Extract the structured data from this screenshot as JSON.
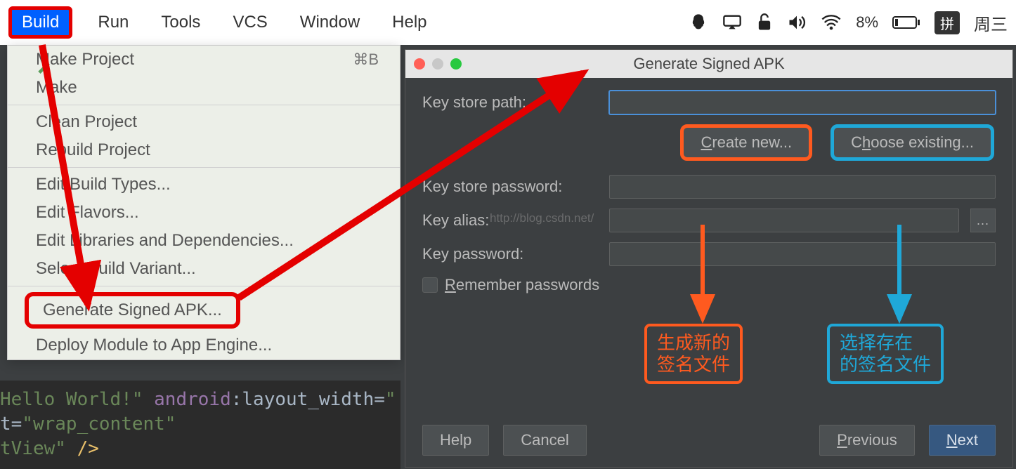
{
  "menubar": {
    "items": [
      "Build",
      "Run",
      "Tools",
      "VCS",
      "Window",
      "Help"
    ],
    "battery": "8%",
    "ime": "拼",
    "day": "周三"
  },
  "dropdown": {
    "make_project": "Make Project",
    "make_project_shortcut": "⌘B",
    "make": "Make",
    "clean": "Clean Project",
    "rebuild": "Rebuild Project",
    "edit_types": "Edit Build Types...",
    "edit_flavors": "Edit Flavors...",
    "edit_libs": "Edit Libraries and Dependencies...",
    "select_variant": "Select Build Variant...",
    "generate_apk": "Generate Signed APK...",
    "deploy": "Deploy Module to App Engine..."
  },
  "code": {
    "line1_a": "Hello World!\"",
    "line1_b": " android",
    "line1_c": ":layout_width=",
    "line1_d": "\"",
    "line2_a": "t=",
    "line2_b": "\"wrap_content\"",
    "line3_a": "tView\" ",
    "line3_b": "/>"
  },
  "dialog": {
    "title": "Generate Signed APK",
    "labels": {
      "store_path": "Key store path:",
      "create_new": "Create new...",
      "choose_existing": "Choose existing...",
      "store_password": "Key store password:",
      "alias": "Key alias:",
      "key_password": "Key password:",
      "remember": "Remember passwords",
      "dots": "..."
    },
    "footer": {
      "help": "Help",
      "cancel": "Cancel",
      "previous": "Previous",
      "next": "Next"
    }
  },
  "annotations": {
    "orange_l1": "生成新的",
    "orange_l2": "签名文件",
    "cyan_l1": "选择存在",
    "cyan_l2": "的签名文件"
  },
  "watermark": "http://blog.csdn.net/"
}
